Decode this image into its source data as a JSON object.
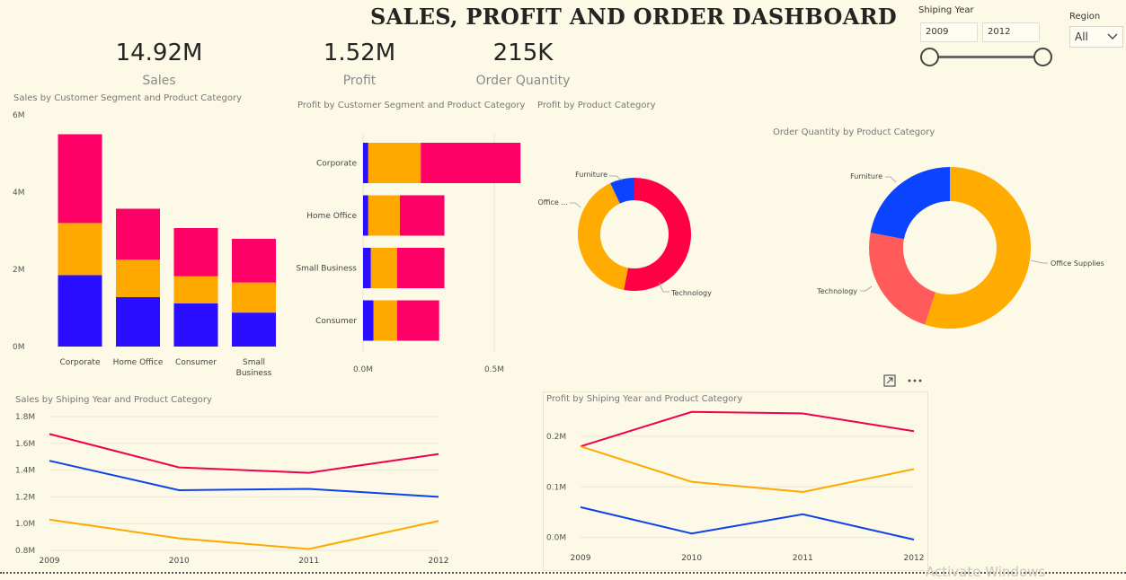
{
  "dashboard": {
    "title": "SALES, PROFIT AND ORDER DASHBOARD"
  },
  "cards": [
    {
      "value": "14.92M",
      "label": "Sales"
    },
    {
      "value": "1.52M",
      "label": "Profit"
    },
    {
      "value": "215K",
      "label": "Order Quantity"
    }
  ],
  "slicers": {
    "year": {
      "label": "Shiping Year",
      "start": "2009",
      "end": "2012",
      "range": [
        2009,
        2012
      ],
      "selected": [
        2009,
        2012
      ]
    },
    "region": {
      "label": "Region",
      "value": "All"
    }
  },
  "colors": {
    "furniture": "#2b0dff",
    "office_supplies": "#ffa800",
    "technology": "#ff0066",
    "line_blue": "#0b43e8",
    "line_pink": "#f0004d",
    "donut_blue": "#0b44ff",
    "donut_pink": "#ff0044",
    "donut_red": "#ff5b5b",
    "donut_orange": "#ffab00"
  },
  "visual_titles": {
    "sales_by_segment": "Sales by Customer Segment and Product Category",
    "profit_by_segment": "Profit by Customer Segment and Product Category",
    "profit_by_category": "Profit by Product Category",
    "order_qty_by_category": "Order Quantity by Product Category",
    "sales_by_year": "Sales by Shiping Year and Product Category",
    "profit_by_year": "Profit by Shiping Year and Product Category"
  },
  "visual_header": {
    "focus_icon": "focus-mode-icon",
    "more_icon": "more-options-icon"
  },
  "watermark": "Activate Windows",
  "chart_data": [
    {
      "type": "bar",
      "stacked": true,
      "orientation": "vertical",
      "title": "Sales by Customer Segment and Product Category",
      "categories": [
        "Corporate",
        "Home Office",
        "Consumer",
        "Small Business"
      ],
      "category_lines": [
        [
          "Corporate"
        ],
        [
          "Home Office"
        ],
        [
          "Consumer"
        ],
        [
          "Small",
          "Business"
        ]
      ],
      "series": [
        {
          "values": [
            1.85,
            1.28,
            1.12,
            0.88
          ]
        },
        {
          "values": [
            1.35,
            0.97,
            0.7,
            0.78
          ]
        },
        {
          "values": [
            2.3,
            1.32,
            1.25,
            1.13
          ]
        }
      ],
      "ylim": [
        0,
        6
      ],
      "yticks": [
        "0M",
        "2M",
        "4M",
        "6M"
      ],
      "ytick_values": [
        0,
        2,
        4,
        6
      ],
      "grid": false
    },
    {
      "type": "bar",
      "stacked": true,
      "orientation": "horizontal",
      "title": "Profit by Customer Segment and Product Category",
      "categories": [
        "Corporate",
        "Home Office",
        "Small Business",
        "Consumer"
      ],
      "series": [
        {
          "values": [
            0.02,
            0.02,
            0.03,
            0.04
          ]
        },
        {
          "values": [
            0.2,
            0.12,
            0.1,
            0.09
          ]
        },
        {
          "values": [
            0.38,
            0.17,
            0.18,
            0.16
          ]
        }
      ],
      "xlim": [
        0,
        0.6
      ],
      "xticks": [
        "0.0M",
        "0.5M"
      ],
      "xtick_values": [
        0,
        0.5
      ],
      "grid": true
    },
    {
      "type": "pie",
      "donut": true,
      "title": "Profit by Product Category",
      "slices": [
        {
          "label": "Furniture",
          "value": 0.07
        },
        {
          "label": "Office ...",
          "value": 0.4
        },
        {
          "label": "Technology",
          "value": 0.53
        }
      ]
    },
    {
      "type": "pie",
      "donut": true,
      "title": "Order Quantity by Product Category",
      "slices": [
        {
          "label": "Furniture",
          "value": 0.22
        },
        {
          "label": "Technology",
          "value": 0.23
        },
        {
          "label": "Office Supplies",
          "value": 0.55
        }
      ]
    },
    {
      "type": "line",
      "title": "Sales by Shiping Year and Product Category",
      "x": [
        "2009",
        "2010",
        "2011",
        "2012"
      ],
      "series": [
        {
          "values": [
            1.67,
            1.42,
            1.38,
            1.52
          ]
        },
        {
          "values": [
            1.47,
            1.25,
            1.26,
            1.2
          ]
        },
        {
          "values": [
            1.03,
            0.89,
            0.81,
            1.02
          ]
        }
      ],
      "ylim": [
        0.8,
        1.8
      ],
      "yticks": [
        "0.8M",
        "1.0M",
        "1.2M",
        "1.4M",
        "1.6M",
        "1.8M"
      ],
      "ytick_values": [
        0.8,
        1.0,
        1.2,
        1.4,
        1.6,
        1.8
      ],
      "grid": true
    },
    {
      "type": "line",
      "title": "Profit by Shiping Year and Product Category",
      "x": [
        "2009",
        "2010",
        "2011",
        "2012"
      ],
      "series": [
        {
          "values": [
            0.18,
            0.248,
            0.245,
            0.21
          ]
        },
        {
          "values": [
            0.18,
            0.11,
            0.09,
            0.135
          ]
        },
        {
          "values": [
            0.06,
            0.008,
            0.046,
            -0.004
          ]
        }
      ],
      "ylim": [
        -0.02,
        0.26
      ],
      "yticks": [
        "0.0M",
        "0.1M",
        "0.2M"
      ],
      "ytick_values": [
        0.0,
        0.1,
        0.2
      ],
      "grid": true
    }
  ]
}
